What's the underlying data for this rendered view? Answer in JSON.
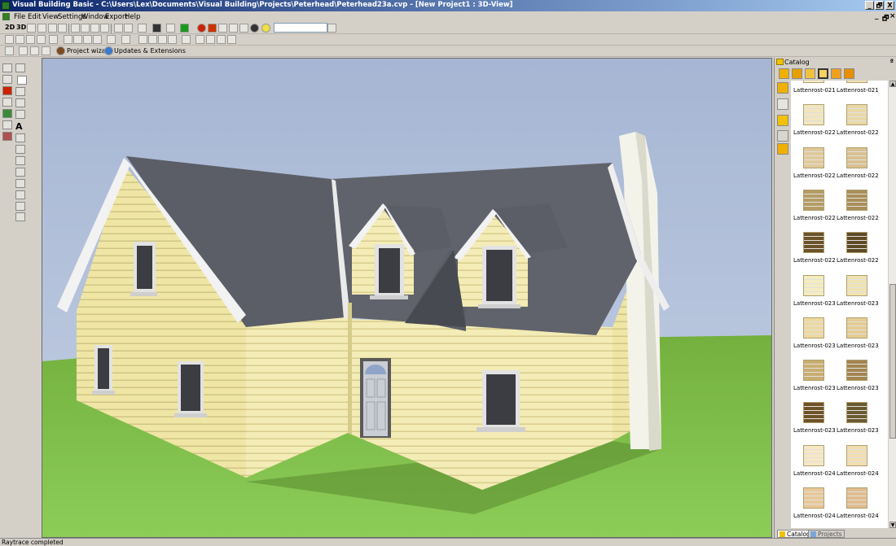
{
  "window": {
    "title": "Visual Building Basic - C:\\Users\\Lex\\Documents\\Visual Building\\Projects\\Peterhead\\Peterhead23a.cvp - [New Project1 : 3D-View]",
    "minimize": "_",
    "restore": "🗗",
    "close": "X"
  },
  "menu": {
    "items": [
      "File",
      "Edit",
      "View",
      "Settings",
      "Window",
      "Export",
      "Help"
    ],
    "mdi_minimize": "_",
    "mdi_restore": "🗗",
    "mdi_close": "×"
  },
  "toolbar": {
    "btn_2d": "2D",
    "btn_3d": "3D",
    "project_wizard": "Project wizard",
    "updates": "Updates & Extensions",
    "colors": {
      "green": "#1a9a1a",
      "red": "#cc2200",
      "blue": "#1c5ed6"
    }
  },
  "left_tools": {
    "text_tool": "A"
  },
  "catalog": {
    "title": "Catalog",
    "pin": "ª",
    "tabs": [
      "Catalog",
      "Projects"
    ],
    "items": [
      {
        "label": "Lattenrost-021_...",
        "color": "#f4ecc6"
      },
      {
        "label": "Lattenrost-021_...",
        "color": "#efe2b4"
      },
      {
        "label": "Lattenrost-022_...",
        "color": "#f1e6bd"
      },
      {
        "label": "Lattenrost-022_...",
        "color": "#e9d8a6"
      },
      {
        "label": "Lattenrost-022_...",
        "color": "#e0c99a"
      },
      {
        "label": "Lattenrost-022_...",
        "color": "#d8c090"
      },
      {
        "label": "Lattenrost-022_...",
        "color": "#b59c64"
      },
      {
        "label": "Lattenrost-022_...",
        "color": "#a88f58"
      },
      {
        "label": "Lattenrost-022_...",
        "color": "#6b5228"
      },
      {
        "label": "Lattenrost-022_...",
        "color": "#5e4a24"
      },
      {
        "label": "Lattenrost-023_...",
        "color": "#f5ecc0"
      },
      {
        "label": "Lattenrost-023_...",
        "color": "#f0e3b2"
      },
      {
        "label": "Lattenrost-023_...",
        "color": "#ecd9a0"
      },
      {
        "label": "Lattenrost-023_...",
        "color": "#e4cc92"
      },
      {
        "label": "Lattenrost-023_...",
        "color": "#c9ad70"
      },
      {
        "label": "Lattenrost-023_...",
        "color": "#a38550"
      },
      {
        "label": "Lattenrost-023_...",
        "color": "#6e5226"
      },
      {
        "label": "Lattenrost-023_...",
        "color": "#6a5a30"
      },
      {
        "label": "Lattenrost-024_...",
        "color": "#f6e8c4"
      },
      {
        "label": "Lattenrost-024_...",
        "color": "#f2ddb0"
      },
      {
        "label": "Lattenrost-024_...",
        "color": "#e8c898"
      },
      {
        "label": "Lattenrost-024_...",
        "color": "#e0bc8c"
      }
    ]
  },
  "status": {
    "text": "Raytrace completed"
  },
  "scene": {
    "colors": {
      "sky": "#b1bfd9",
      "grass": "#7fb84a",
      "cladding": "#eee6a8",
      "roof": "#5b5e66",
      "trim": "#f2f2f2",
      "door": "#c8ccd2"
    }
  }
}
